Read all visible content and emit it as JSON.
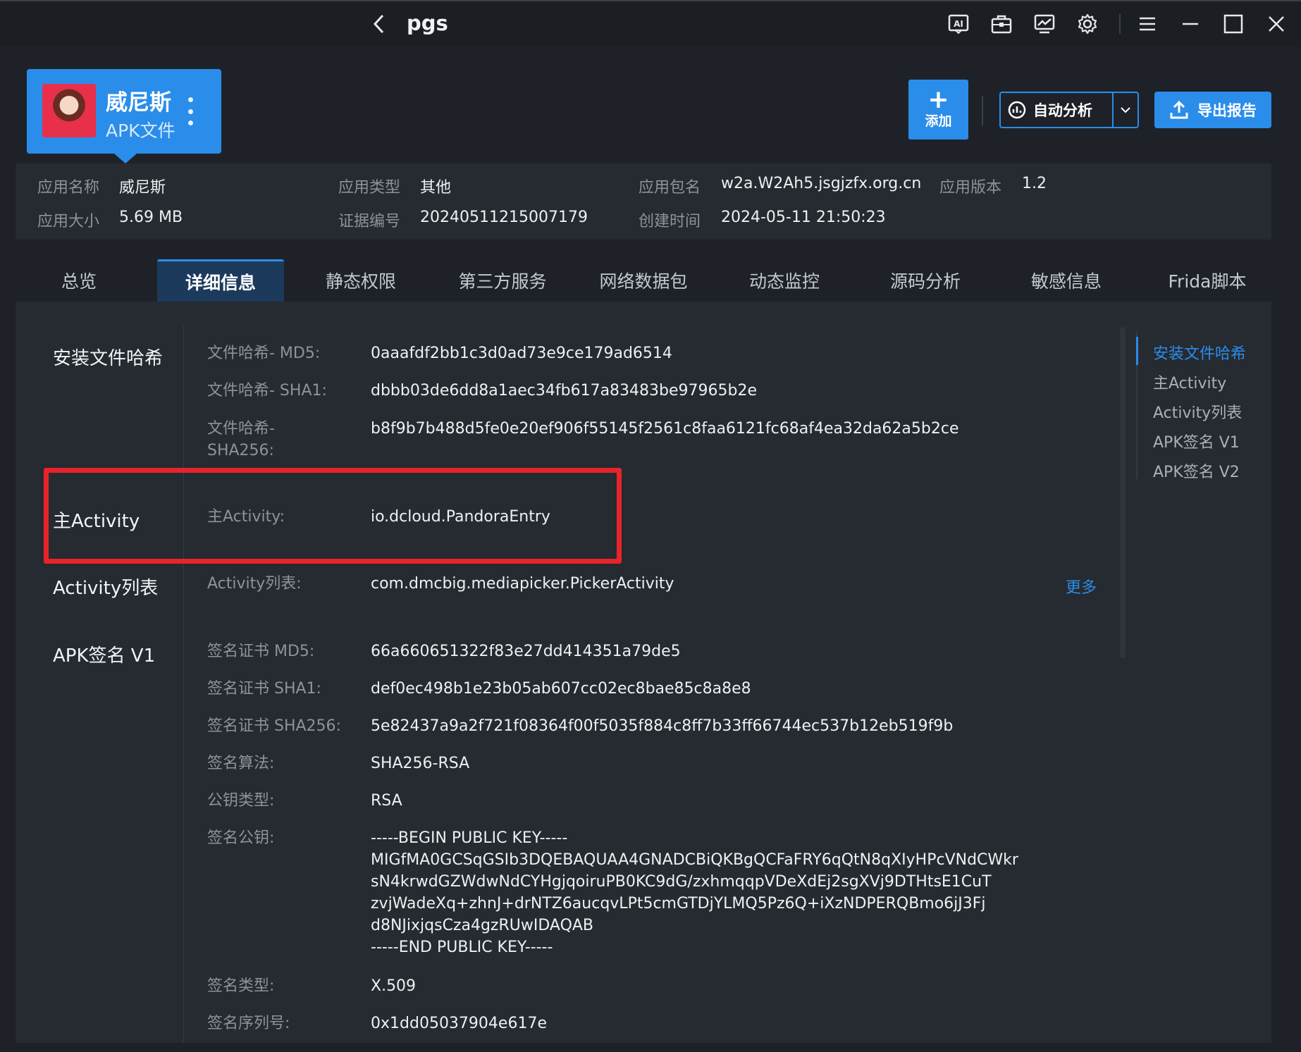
{
  "window": {
    "title": "pgs",
    "icons": [
      "ai-icon",
      "toolbox-icon",
      "monitor-chart-icon",
      "gear-icon",
      "menu-icon",
      "minimize-icon",
      "maximize-icon",
      "close-icon"
    ]
  },
  "app": {
    "name": "威尼斯",
    "type_label": "APK文件"
  },
  "actions": {
    "add_label": "添加",
    "auto_label": "自动分析",
    "export_label": "导出报告"
  },
  "info": {
    "name_k": "应用名称",
    "name_v": "威尼斯",
    "category_k": "应用类型",
    "category_v": "其他",
    "package_k": "应用包名",
    "package_v": "w2a.W2Ah5.jsgjzfx.org.cn",
    "version_k": "应用版本",
    "version_v": "1.2",
    "size_k": "应用大小",
    "size_v": "5.69 MB",
    "evidence_k": "证据编号",
    "evidence_v": "20240511215007179",
    "created_k": "创建时间",
    "created_v": "2024-05-11 21:50:23"
  },
  "tabs": [
    "总览",
    "详细信息",
    "静态权限",
    "第三方服务",
    "网络数据包",
    "动态监控",
    "源码分析",
    "敏感信息",
    "Frida脚本"
  ],
  "active_tab": "详细信息",
  "sections": {
    "hash": {
      "title": "安装文件哈希",
      "md5_k": "文件哈希- MD5:",
      "md5_v": "0aaafdf2bb1c3d0ad73e9ce179ad6514",
      "sha1_k": "文件哈希- SHA1:",
      "sha1_v": "dbbb03de6dd8a1aec34fb617a83483be97965b2e",
      "sha256_k": "文件哈希- SHA256:",
      "sha256_v": "b8f9b7b488d5fe0e20ef906f55145f2561c8faa6121fc68af4ea32da62a5b2ce"
    },
    "main_activity": {
      "title": "主Activity",
      "k": "主Activity:",
      "v": "io.dcloud.PandoraEntry"
    },
    "activity_list": {
      "title": "Activity列表",
      "k": "Activity列表:",
      "v": "com.dmcbig.mediapicker.PickerActivity",
      "more": "更多"
    },
    "sign_v1": {
      "title": "APK签名 V1",
      "md5_k": "签名证书 MD5:",
      "md5_v": "66a660651322f83e27dd414351a79de5",
      "sha1_k": "签名证书 SHA1:",
      "sha1_v": "def0ec498b1e23b05ab607cc02ec8bae85c8a8e8",
      "sha256_k": "签名证书 SHA256:",
      "sha256_v": "5e82437a9a2f721f08364f00f5035f884c8ff7b33ff66744ec537b12eb519f9b",
      "algo_k": "签名算法:",
      "algo_v": "SHA256-RSA",
      "keytype_k": "公钥类型:",
      "keytype_v": "RSA",
      "pubkey_k": "签名公钥:",
      "pubkey_lines": [
        "-----BEGIN PUBLIC KEY-----",
        "MIGfMA0GCSqGSIb3DQEBAQUAA4GNADCBiQKBgQCFaFRY6qQtN8qXIyHPcVNdCWkr",
        "sN4krwdGZWdwNdCYHgjqoiruPB0KC9dG/zxhmqqpVDeXdEj2sgXVj9DTHtsE1CuT",
        "zvjWadeXq+zhnJ+drNTZ6aucqvLPt5cmGTDjYLMQ5Pz6Q+iXzNDPERQBmo6jJ3Fj",
        "d8NJixjqsCza4gzRUwIDAQAB",
        "-----END PUBLIC KEY-----"
      ],
      "certtype_k": "签名类型:",
      "certtype_v": "X.509",
      "serial_k": "签名序列号:",
      "serial_v": "0x1dd05037904e617e"
    }
  },
  "anchor_nav": [
    "安装文件哈希",
    "主Activity",
    "Activity列表",
    "APK签名 V1",
    "APK签名 V2"
  ],
  "anchor_active": "安装文件哈希",
  "colors": {
    "accent": "#2a8dea",
    "highlight": "#e8232b",
    "background": "#1e2228",
    "panel": "#262a31"
  }
}
